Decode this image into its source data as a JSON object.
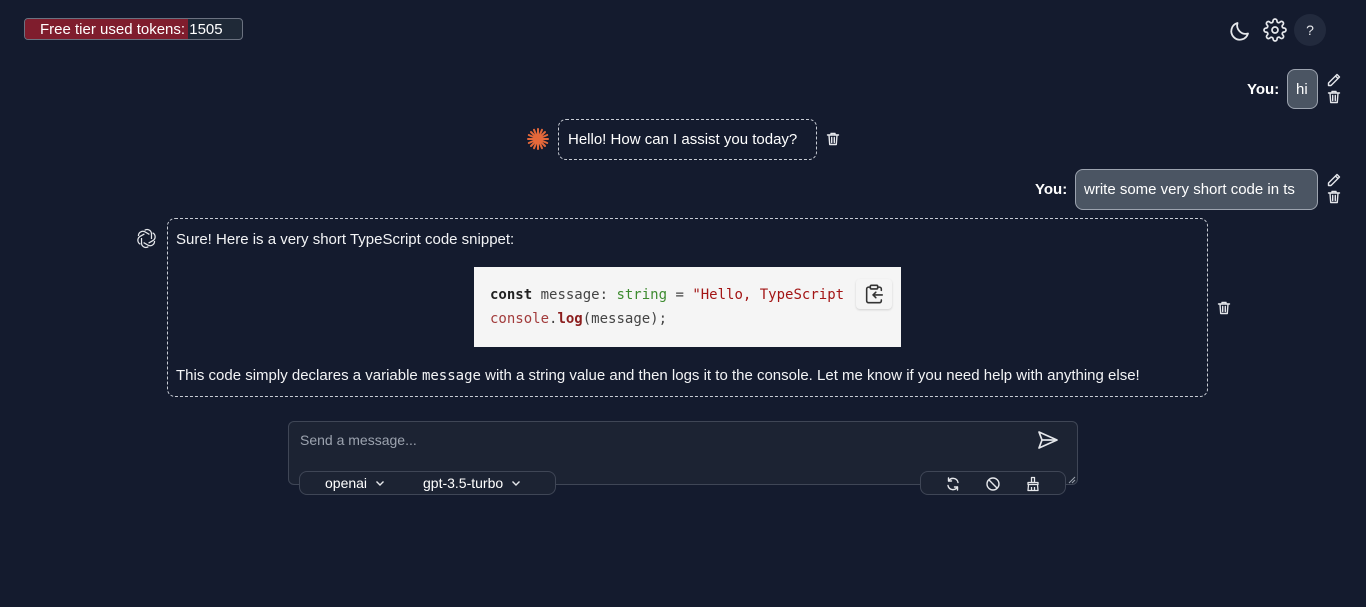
{
  "header": {
    "tokens_label": "Free tier used tokens:",
    "tokens_value": "1505",
    "tokens_fill_fraction": 0.75,
    "theme_icon": "moon-icon",
    "settings_icon": "gear-icon",
    "help_label": "?"
  },
  "chat": {
    "messages": [
      {
        "role": "user",
        "label": "You:",
        "text": "hi"
      },
      {
        "role": "assistant",
        "icon": "claude-sunburst-icon",
        "text": "Hello! How can I assist you today?"
      },
      {
        "role": "user",
        "label": "You:",
        "text": "write some very short code in ts"
      },
      {
        "role": "assistant",
        "icon": "openai-logo-icon",
        "intro": "Sure! Here is a very short TypeScript code snippet:",
        "code": {
          "line1": {
            "kw": "const",
            "name": " message: ",
            "type": "string",
            "eq": " = ",
            "str": "\"Hello, TypeScript"
          },
          "line2": {
            "obj": "console",
            "dot": ".",
            "fn": "log",
            "rest": "(message);"
          }
        },
        "outro_before": "This code simply declares a variable ",
        "outro_code": "message",
        "outro_after": " with a string value and then logs it to the console. Let me know if you need help with anything else!"
      }
    ]
  },
  "composer": {
    "placeholder": "Send a message...",
    "provider": "openai",
    "model": "gpt-3.5-turbo",
    "send_icon": "send-icon",
    "actions": [
      "refresh-icon",
      "block-icon",
      "broom-icon"
    ]
  },
  "colors": {
    "background": "#141b2e",
    "token_fill": "#7f1d2d",
    "user_bubble": "#4b5563"
  }
}
